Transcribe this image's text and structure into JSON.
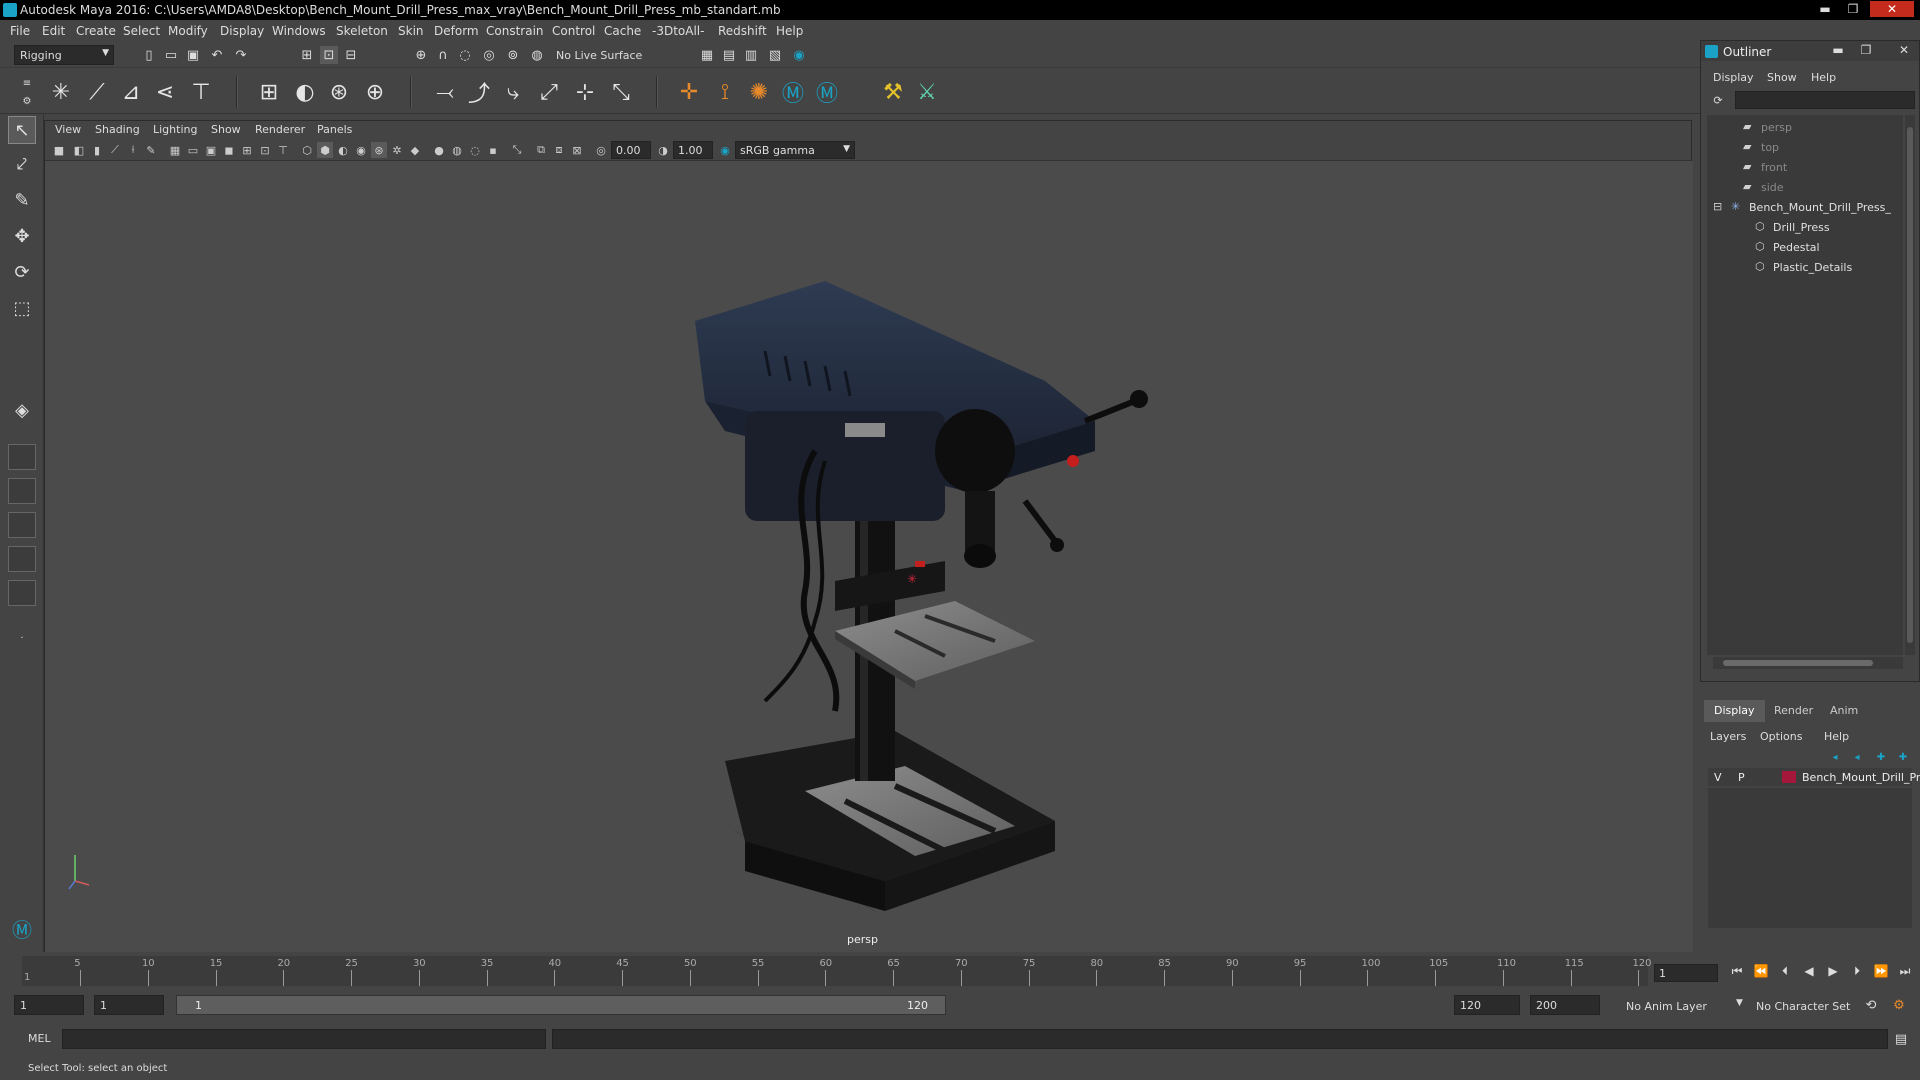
{
  "window": {
    "title": "Autodesk Maya 2016: C:\\Users\\AMDA8\\Desktop\\Bench_Mount_Drill_Press_max_vray\\Bench_Mount_Drill_Press_mb_standart.mb",
    "minimize": "▬",
    "maximize": "❐",
    "close": "✕"
  },
  "menubar": [
    "File",
    "Edit",
    "Create",
    "Select",
    "Modify",
    "Display",
    "Windows",
    "Skeleton",
    "Skin",
    "Deform",
    "Constrain",
    "Control",
    "Cache",
    "-3DtoAll-",
    "Redshift",
    "Help"
  ],
  "statusline": {
    "mode": "Rigging",
    "live_surface": "No Live Surface"
  },
  "viewport": {
    "menu": [
      "View",
      "Shading",
      "Lighting",
      "Show",
      "Renderer",
      "Panels"
    ],
    "exposure": "0.00",
    "gamma": "1.00",
    "color_space": "sRGB gamma",
    "camera": "persp"
  },
  "outliner": {
    "title": "Outliner",
    "menu": [
      "Display",
      "Show",
      "Help"
    ],
    "items": [
      {
        "label": "persp",
        "indent": 1,
        "dim": true,
        "icon": "camera-icon"
      },
      {
        "label": "top",
        "indent": 1,
        "dim": true,
        "icon": "camera-icon"
      },
      {
        "label": "front",
        "indent": 1,
        "dim": true,
        "icon": "camera-icon"
      },
      {
        "label": "side",
        "indent": 1,
        "dim": true,
        "icon": "camera-icon"
      },
      {
        "label": "Bench_Mount_Drill_Press_",
        "indent": 0,
        "dim": false,
        "icon": "group-icon"
      },
      {
        "label": "Drill_Press",
        "indent": 2,
        "dim": false,
        "icon": "mesh-icon"
      },
      {
        "label": "Pedestal",
        "indent": 2,
        "dim": false,
        "icon": "mesh-icon"
      },
      {
        "label": "Plastic_Details",
        "indent": 2,
        "dim": false,
        "icon": "mesh-icon"
      }
    ]
  },
  "layers": {
    "tabs": [
      "Display",
      "Render",
      "Anim"
    ],
    "active_tab": "Display",
    "menu": [
      "Layers",
      "Options",
      "Help"
    ],
    "row": {
      "v": "V",
      "p": "P",
      "name": "Bench_Mount_Drill_Pr",
      "color": "#a3173a"
    }
  },
  "timeline": {
    "ticks": [
      "5",
      "10",
      "15",
      "20",
      "25",
      "30",
      "35",
      "40",
      "45",
      "50",
      "55",
      "60",
      "65",
      "70",
      "75",
      "80",
      "85",
      "90",
      "95",
      "100",
      "105",
      "110",
      "115",
      "120"
    ],
    "start_label": "1",
    "current_frame": "1"
  },
  "range": {
    "start": "1",
    "playback_start": "1",
    "slider_start": "1",
    "slider_end": "120",
    "playback_end": "120",
    "end": "200",
    "anim_layer": "No Anim Layer",
    "character_set": "No Character Set"
  },
  "cmdline": {
    "lang": "MEL"
  },
  "helpline": {
    "text": "Select Tool: select an object"
  },
  "colors": {
    "accent": "#1aa3c7",
    "layer_color": "#a3173a"
  }
}
